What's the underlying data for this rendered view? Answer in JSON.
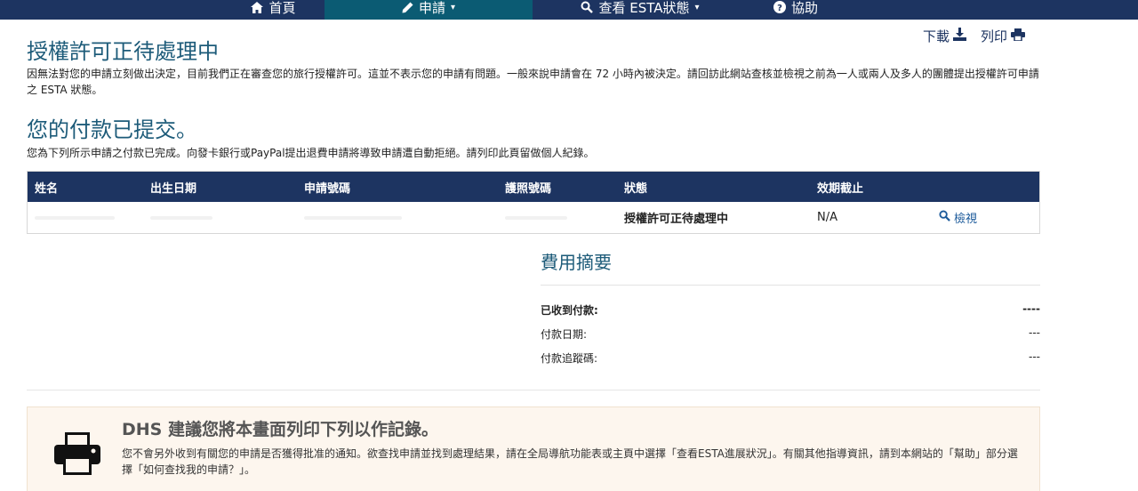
{
  "nav": {
    "items": [
      {
        "label": "首頁",
        "icon": "home-icon"
      },
      {
        "label": "申請",
        "icon": "edit-icon",
        "caret": "▾"
      },
      {
        "label": "查看 ESTA狀態",
        "icon": "search-icon",
        "caret": "▾"
      },
      {
        "label": "協助",
        "icon": "help-icon"
      }
    ]
  },
  "tools": {
    "download_label": "下載",
    "print_label": "列印"
  },
  "pending": {
    "title": "授權許可正待處理中",
    "body": "因無法對您的申請立刻做出決定，目前我們正在審查您的旅行授權許可。這並不表示您的申請有問題。一般來說申請會在 72 小時內被決定。請回訪此網站查核並檢視之前為一人或兩人及多人的團體提出授權許可申請之 ESTA 狀態。"
  },
  "payment": {
    "title": "您的付款已提交。",
    "body": "您為下列所示申請之付款已完成。向發卡銀行或PayPal提出退費申請將導致申請遭自動拒絕。請列印此頁留做個人紀錄。"
  },
  "table": {
    "headers": [
      "姓名",
      "出生日期",
      "申請號碼",
      "護照號碼",
      "狀態",
      "效期截止"
    ],
    "rows": [
      {
        "status": "授權許可正待處理中",
        "expiry": "N/A",
        "action": "檢視"
      }
    ]
  },
  "fee_summary": {
    "title": "費用摘要",
    "rows": [
      {
        "label": "已收到付款:",
        "value": "----",
        "bold": true
      },
      {
        "label": "付款日期:",
        "value": "---",
        "bold": false
      },
      {
        "label": "付款追蹤碼:",
        "value": "---",
        "bold": false
      }
    ]
  },
  "notice": {
    "title": "DHS 建議您將本畫面列印下列以作記錄。",
    "body": "您不會另外收到有關您的申請是否獲得批准的通知。欲查找申請並找到處理結果，請在全局導航功能表或主頁中選擇「查看ESTA進展狀況」。有關其他指導資訊，請到本網站的「幫助」部分選擇「如何查找我的申請？」。"
  },
  "colors": {
    "navy": "#1d3461",
    "teal_active": "#0b5b73",
    "heading": "#1d5b79",
    "notice_bg": "#fdf6ee"
  }
}
